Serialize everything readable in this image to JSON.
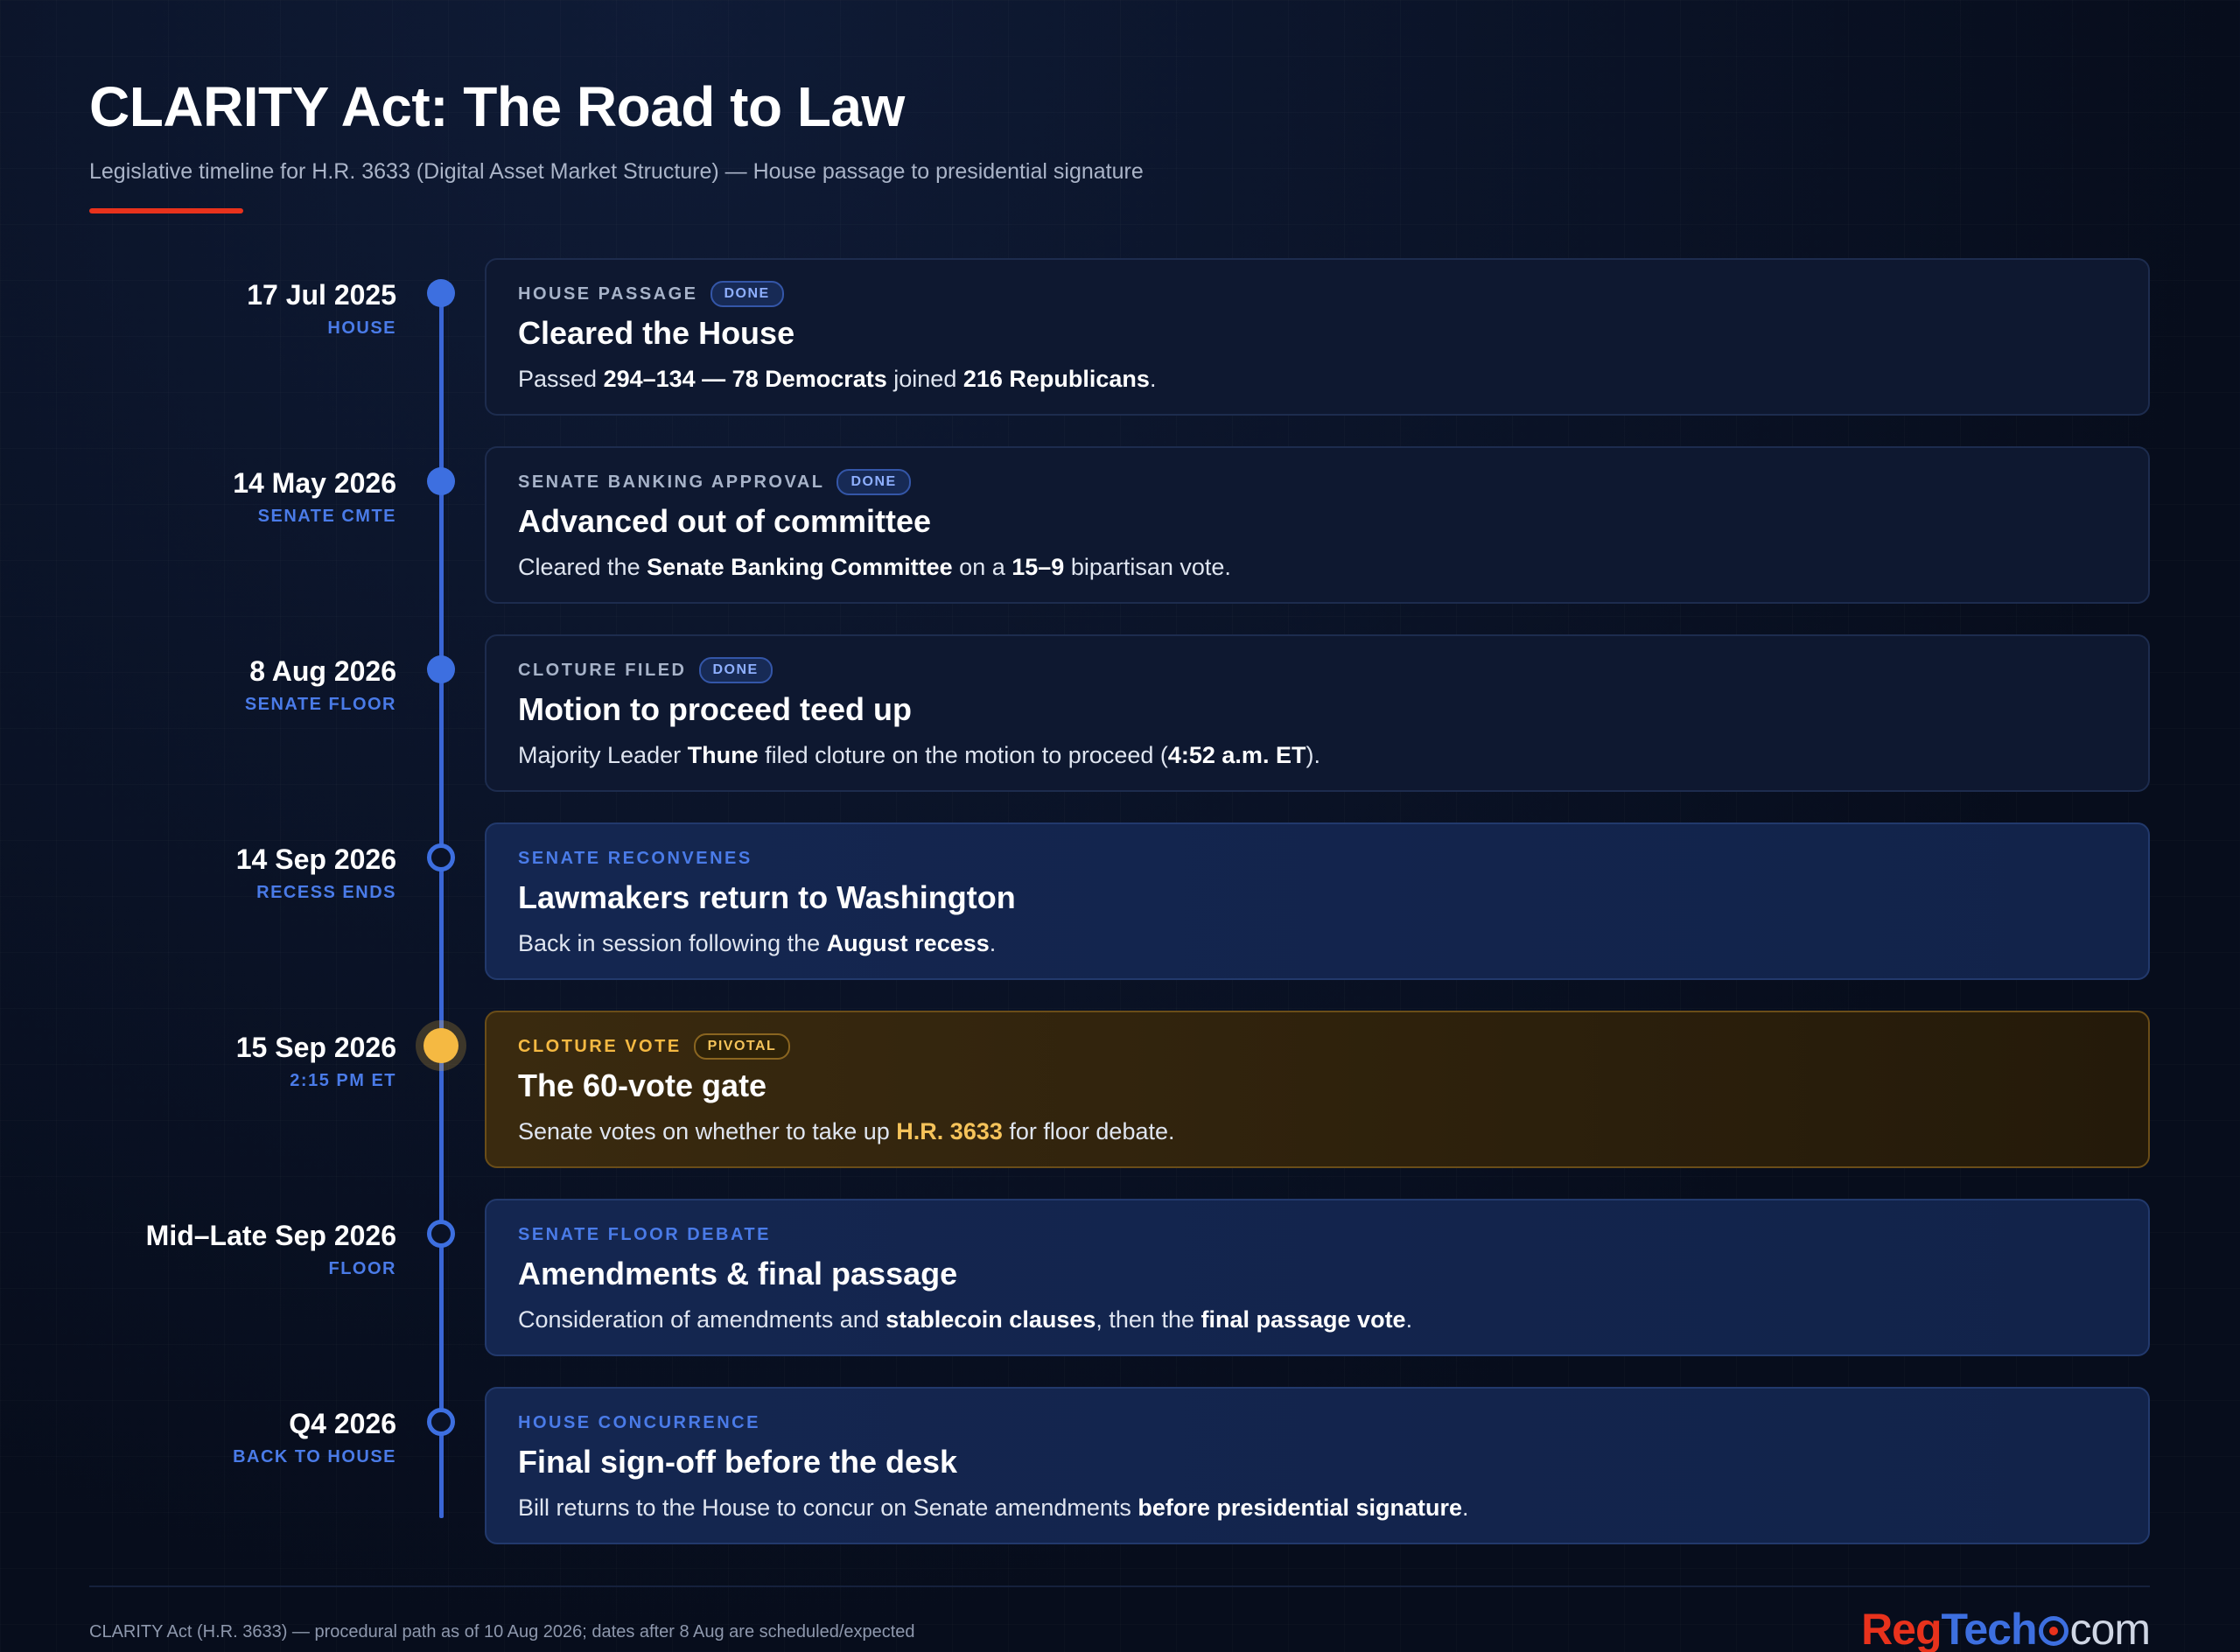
{
  "header": {
    "title": "CLARITY Act: The Road to Law",
    "subtitle": "Legislative timeline for H.R. 3633 (Digital Asset Market Structure) — House passage to presidential signature"
  },
  "colors": {
    "accent_red": "#e8321c",
    "timeline_blue": "#3d6fe0",
    "pivotal_gold": "#f5b942"
  },
  "events": [
    {
      "date": "17 Jul 2025",
      "tag": "HOUSE",
      "status": "done",
      "kicker": "HOUSE PASSAGE",
      "badge": "DONE",
      "title": "Cleared the House",
      "desc": [
        "Passed ",
        "294–134 — 78 Democrats",
        " joined ",
        "216 Republicans",
        "."
      ]
    },
    {
      "date": "14 May 2026",
      "tag": "SENATE CMTE",
      "status": "done",
      "kicker": "SENATE BANKING APPROVAL",
      "badge": "DONE",
      "title": "Advanced out of committee",
      "desc": [
        "Cleared the ",
        "Senate Banking Committee",
        " on a ",
        "15–9",
        " bipartisan vote."
      ]
    },
    {
      "date": "8 Aug 2026",
      "tag": "SENATE FLOOR",
      "status": "done",
      "kicker": "CLOTURE FILED",
      "badge": "DONE",
      "title": "Motion to proceed teed up",
      "desc": [
        "Majority Leader ",
        "Thune",
        " filed cloture on the motion to proceed (",
        "4:52 a.m. ET",
        ")."
      ]
    },
    {
      "date": "14 Sep 2026",
      "tag": "RECESS ENDS",
      "status": "upcoming",
      "kicker": "SENATE RECONVENES",
      "badge": "",
      "title": "Lawmakers return to Washington",
      "desc": [
        "Back in session following the ",
        "August recess",
        "."
      ]
    },
    {
      "date": "15 Sep 2026",
      "tag": "2:15 PM ET",
      "status": "pivotal",
      "kicker": "CLOTURE VOTE",
      "badge": "PIVOTAL",
      "title": "The 60-vote gate",
      "desc": [
        "Senate votes on whether to take up ",
        "H.R. 3633",
        " for floor debate."
      ]
    },
    {
      "date": "Mid–Late Sep 2026",
      "tag": "FLOOR",
      "status": "upcoming",
      "kicker": "SENATE FLOOR DEBATE",
      "badge": "",
      "title": "Amendments & final passage",
      "desc": [
        "Consideration of amendments and ",
        "stablecoin clauses",
        ", then the ",
        "final passage vote",
        "."
      ]
    },
    {
      "date": "Q4 2026",
      "tag": "BACK TO HOUSE",
      "status": "upcoming",
      "kicker": "HOUSE CONCURRENCE",
      "badge": "",
      "title": "Final sign-off before the desk",
      "desc": [
        "Bill returns to the House to concur on Senate amendments ",
        "before presidential signature",
        "."
      ]
    }
  ],
  "footer": {
    "note": "CLARITY Act (H.R. 3633) — procedural path as of 10 Aug 2026; dates after 8 Aug are scheduled/expected",
    "brand_reg": "Reg",
    "brand_tech": "Tech",
    "brand_com": "com"
  }
}
